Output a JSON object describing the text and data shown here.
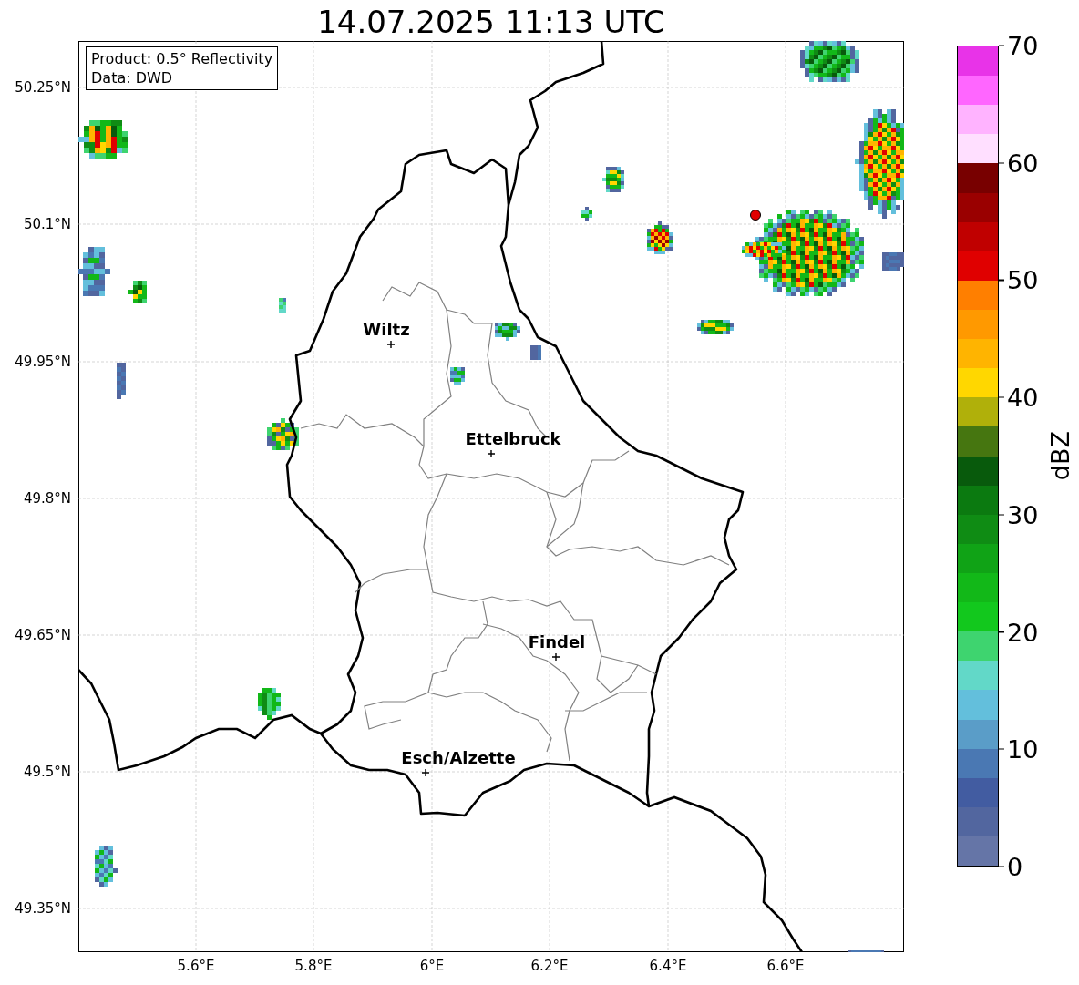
{
  "title": "14.07.2025 11:13 UTC",
  "info_box": [
    "Product: 0.5° Reflectivity",
    "Data: DWD"
  ],
  "map": {
    "lat_labels": [
      "50.25°N",
      "50.1°N",
      "49.95°N",
      "49.8°N",
      "49.65°N",
      "49.5°N",
      "49.35°N"
    ],
    "lon_labels": [
      "5.6°E",
      "5.8°E",
      "6°E",
      "6.2°E",
      "6.4°E",
      "6.6°E"
    ],
    "places": [
      {
        "name": "Wiltz"
      },
      {
        "name": "Ettelbruck"
      },
      {
        "name": "Findel"
      },
      {
        "name": "Esch/Alzette"
      }
    ]
  },
  "colorbar": {
    "label": "dBZ",
    "ticks": [
      "70",
      "60",
      "50",
      "40",
      "30",
      "20",
      "10",
      "0"
    ],
    "bands": [
      {
        "color": "#e833e8"
      },
      {
        "color": "#ff66ff"
      },
      {
        "color": "#ffb3ff"
      },
      {
        "color": "#ffdfff"
      },
      {
        "color": "#780000"
      },
      {
        "color": "#9a0000"
      },
      {
        "color": "#c00000"
      },
      {
        "color": "#e00000"
      },
      {
        "color": "#ff7f00"
      },
      {
        "color": "#ff9900"
      },
      {
        "color": "#ffb400"
      },
      {
        "color": "#ffd700"
      },
      {
        "color": "#b0b00a"
      },
      {
        "color": "#467610"
      },
      {
        "color": "#085a0c"
      },
      {
        "color": "#0b7a10"
      },
      {
        "color": "#0f8c14"
      },
      {
        "color": "#10a316"
      },
      {
        "color": "#12b818"
      },
      {
        "color": "#12c81d"
      },
      {
        "color": "#3ed46f"
      },
      {
        "color": "#62d8c8"
      },
      {
        "color": "#63bfdc"
      },
      {
        "color": "#5a9dc8"
      },
      {
        "color": "#4a78b3"
      },
      {
        "color": "#425ca1"
      },
      {
        "color": "#52669f"
      },
      {
        "color": "#6575a7"
      }
    ]
  }
}
